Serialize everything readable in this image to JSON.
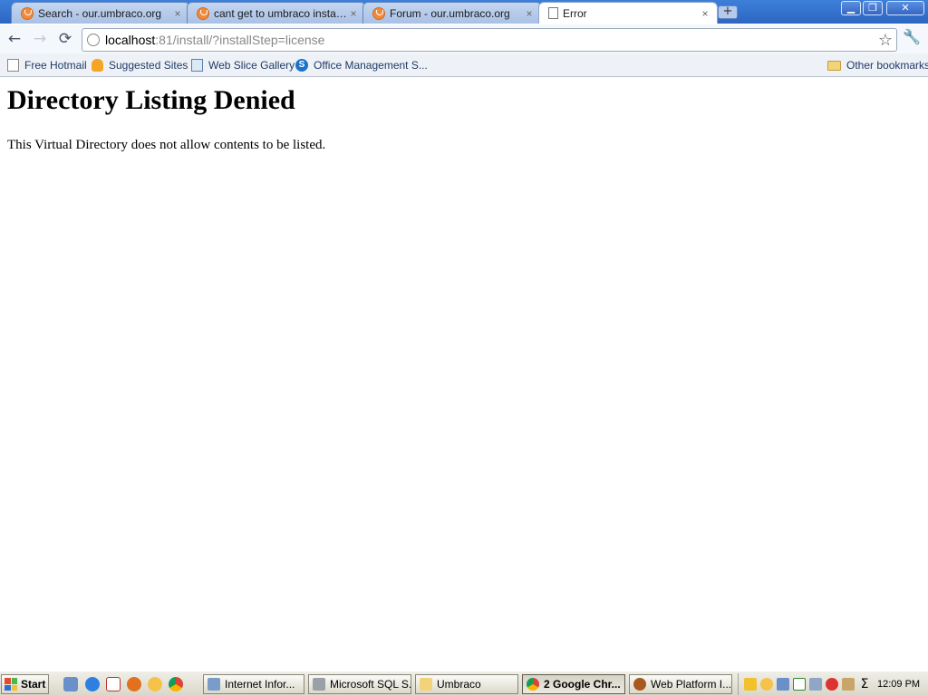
{
  "browser": {
    "tabs": [
      {
        "title": "Search - our.umbraco.org",
        "active": false
      },
      {
        "title": "cant get to umbraco install...",
        "active": false
      },
      {
        "title": "Forum - our.umbraco.org",
        "active": false
      },
      {
        "title": "Error",
        "active": true
      }
    ],
    "tab_close_glyph": "×",
    "new_tab_glyph": "+",
    "window_controls": {
      "minimize": "▁",
      "restore": "❐",
      "close": "✕"
    }
  },
  "toolbar": {
    "back_glyph": "←",
    "forward_glyph": "→",
    "reload_glyph": "⟳",
    "url_host": "localhost",
    "url_path": ":81/install/?installStep=license",
    "star_glyph": "☆",
    "wrench_glyph": "🔧"
  },
  "bookmarks": {
    "items": [
      {
        "label": "Free Hotmail",
        "icon": "page-icon"
      },
      {
        "label": "Suggested Sites",
        "icon": "bulb-icon"
      },
      {
        "label": "Web Slice Gallery",
        "icon": "web-slice-icon"
      },
      {
        "label": "Office Management S...",
        "icon": "s-logo-icon"
      }
    ],
    "other_label": "Other bookmarks"
  },
  "page": {
    "heading": "Directory Listing Denied",
    "message": "This Virtual Directory does not allow contents to be listed."
  },
  "taskbar": {
    "start_label": "Start",
    "tasks": [
      {
        "label": "Internet Infor...",
        "active": false
      },
      {
        "label": "Microsoft SQL S...",
        "active": false
      },
      {
        "label": "Umbraco",
        "active": false
      },
      {
        "label": "2 Google Chr...",
        "active": true
      },
      {
        "label": "Web Platform I...",
        "active": false
      }
    ],
    "clock": "12:09 PM"
  },
  "colors": {
    "tabstrip": "#2c66c2",
    "link": "#1f3a66",
    "start_logo": [
      "#e34a2f",
      "#4db84a",
      "#2f6fd6",
      "#f3c22b"
    ]
  }
}
